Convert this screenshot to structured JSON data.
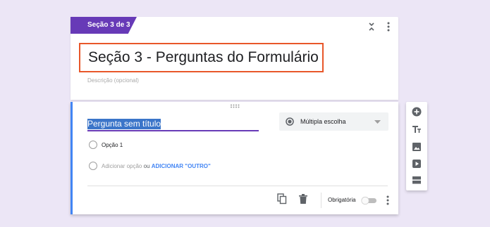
{
  "section": {
    "tab_label": "Seção 3 de 3",
    "title": "Seção 3 - Perguntas do Formulário",
    "description_placeholder": "Descrição (opcional)"
  },
  "question": {
    "title": "Pergunta sem título",
    "type": "Múltipla escolha",
    "options": [
      "Opção 1"
    ],
    "add_option": "Adicionar opção",
    "add_option_conj": "ou",
    "add_other": "ADICIONAR \"OUTRO\"",
    "required_label": "Obrigatória",
    "required": false
  },
  "toolbar_icons": [
    "add-question-icon",
    "title-text-icon",
    "image-icon",
    "video-icon",
    "section-icon"
  ],
  "colors": {
    "background": "#ece6f6",
    "accent": "#673ab7",
    "highlight": "#e8572a",
    "link": "#4285f4"
  }
}
